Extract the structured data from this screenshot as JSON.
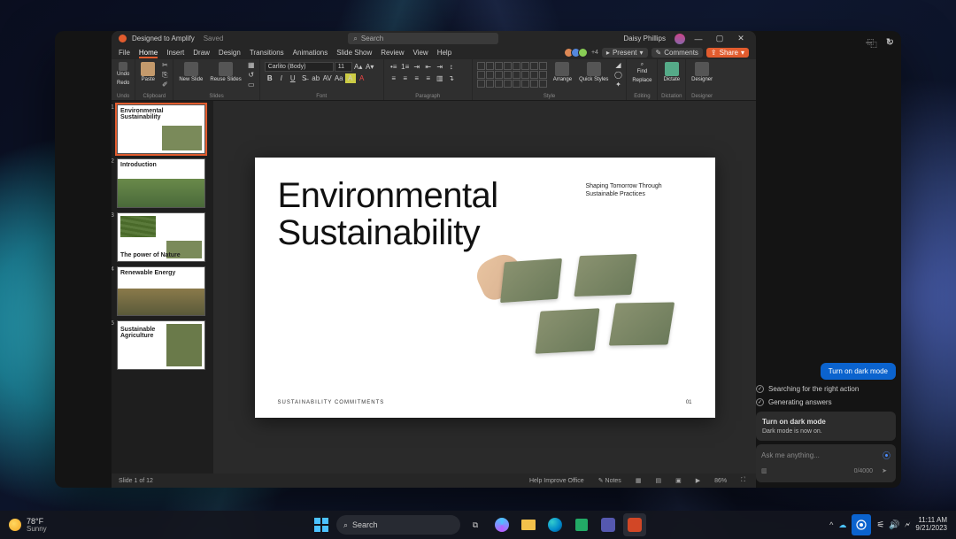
{
  "machine_window": {
    "min": "–",
    "close": "×"
  },
  "copilot_icons": {
    "restore": "⿻",
    "refresh": "↻"
  },
  "ppt": {
    "title": "Designed to Amplify",
    "saved": "Saved",
    "search_placeholder": "Search",
    "user": "Daisy Phillips",
    "extra_users": "+4",
    "menus": [
      "File",
      "Home",
      "Insert",
      "Draw",
      "Design",
      "Transitions",
      "Animations",
      "Slide Show",
      "Review",
      "View",
      "Help"
    ],
    "active_menu": "Home",
    "present": "Present",
    "comments": "Comments",
    "share": "Share",
    "ribbon": {
      "undo": {
        "undo": "Undo",
        "redo": "Redo",
        "label": "Undo"
      },
      "clipboard": {
        "paste": "Paste",
        "label": "Clipboard"
      },
      "slides": {
        "new": "New Slide",
        "reuse": "Reuse Slides",
        "label": "Slides"
      },
      "font": {
        "family": "Carlito (Body)",
        "size": "11",
        "label": "Font"
      },
      "paragraph": {
        "label": "Paragraph"
      },
      "style": {
        "label": "Style"
      },
      "arrange": "Arrange",
      "quick": "Quick Styles",
      "editing": {
        "find": "Find",
        "replace": "Replace",
        "label": "Editing"
      },
      "dictate": {
        "btn": "Dictate",
        "label": "Dictation"
      },
      "designer": {
        "btn": "Designer",
        "label": "Designer"
      }
    },
    "thumbs": [
      {
        "n": "1",
        "title": "Environmental Sustainability"
      },
      {
        "n": "2",
        "title": "Introduction"
      },
      {
        "n": "3",
        "title": "The power of Nature"
      },
      {
        "n": "4",
        "title": "Renewable Energy"
      },
      {
        "n": "5",
        "title": "Sustainable Agriculture"
      }
    ],
    "slide": {
      "heading_l1": "Environmental",
      "heading_l2": "Sustainability",
      "tagline": "Shaping Tomorrow Through Sustainable Practices",
      "commit": "SUSTAINABILITY COMMITMENTS",
      "page": "01"
    },
    "status": {
      "left": "Slide 1 of 12",
      "help": "Help Improve Office",
      "notes": "Notes",
      "zoom": "86%"
    }
  },
  "copilot": {
    "user_msg": "Turn on dark mode",
    "step1": "Searching for the right action",
    "step2": "Generating answers",
    "card_title": "Turn on dark mode",
    "card_body": "Dark mode is now on.",
    "placeholder": "Ask me anything...",
    "counter": "0/4000"
  },
  "taskbar": {
    "temp": "78°F",
    "cond": "Sunny",
    "search": "Search",
    "time": "11:11 AM",
    "date": "9/21/2023"
  }
}
